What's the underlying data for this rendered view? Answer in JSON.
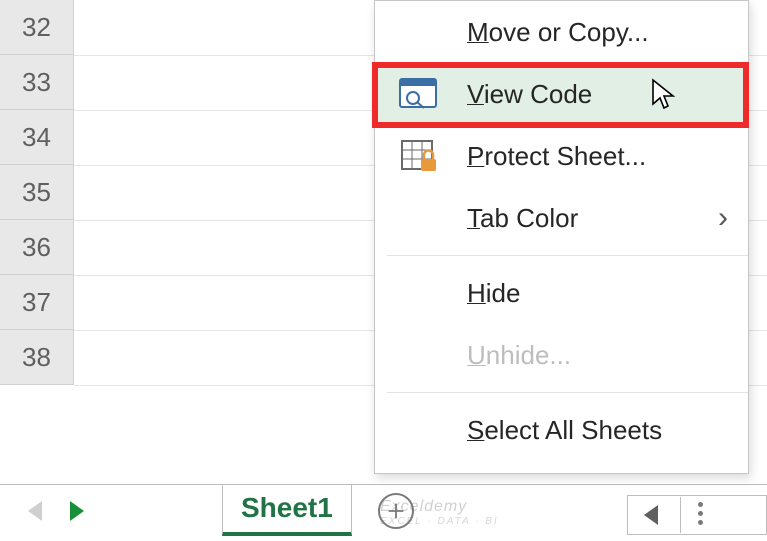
{
  "rows": [
    "32",
    "33",
    "34",
    "35",
    "36",
    "37",
    "38"
  ],
  "sheet": {
    "active_tab": "Sheet1"
  },
  "watermark": {
    "brand": "Exceldemy",
    "tag": "EXCEL · DATA · BI"
  },
  "menu": {
    "move_or_copy": "ove or Copy...",
    "view_code": "iew Code",
    "protect_sheet": "rotect Sheet...",
    "tab_color": "ab Color",
    "hide": "ide",
    "unhide": "nhide...",
    "select_all": "elect All Sheets",
    "mnemonics": {
      "move": "M",
      "view": "V",
      "protect": "P",
      "tab": "T",
      "hide": "H",
      "unhide": "U",
      "select": "S"
    }
  }
}
